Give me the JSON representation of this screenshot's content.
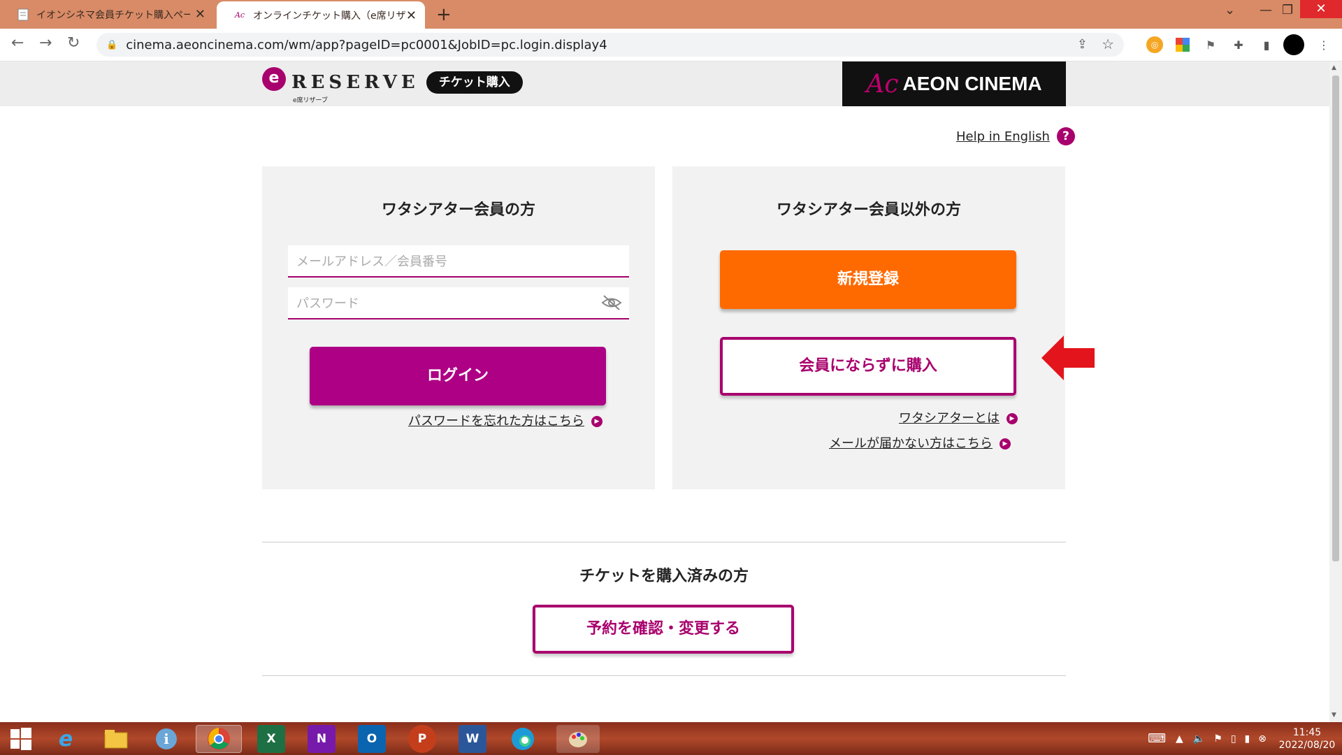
{
  "browser": {
    "tabs": [
      {
        "label": "イオンシネマ会員チケット購入ページ",
        "active": false
      },
      {
        "label": "オンラインチケット購入（e席リザーブ）",
        "active": true
      }
    ],
    "url": "cinema.aeoncinema.com/wm/app?pageID=pc0001&JobID=pc.login.display4"
  },
  "header": {
    "logo_text": "RESERVE",
    "logo_sub": "e席リザーブ",
    "ticket_pill": "チケット購入",
    "brand_mark": "Ac",
    "brand_name": "AEON CINEMA"
  },
  "help": {
    "label": "Help in English",
    "icon": "?"
  },
  "member_panel": {
    "title": "ワタシアター会員の方",
    "email_placeholder": "メールアドレス／会員番号",
    "password_placeholder": "パスワード",
    "login_label": "ログイン",
    "forgot_link": "パスワードを忘れた方はこちら"
  },
  "guest_panel": {
    "title": "ワタシアター会員以外の方",
    "register_label": "新規登録",
    "guest_label": "会員にならずに購入",
    "about_link": "ワタシアターとは",
    "mail_link": "メールが届かない方はこちら"
  },
  "purchased": {
    "title": "チケットを購入済みの方",
    "confirm_label": "予約を確認・変更する"
  },
  "taskbar": {
    "time": "11:45",
    "date": "2022/08/20"
  },
  "colors": {
    "brand_magenta": "#ad0085",
    "register_orange": "#ff6a00",
    "annotation_red": "#e3141c"
  }
}
